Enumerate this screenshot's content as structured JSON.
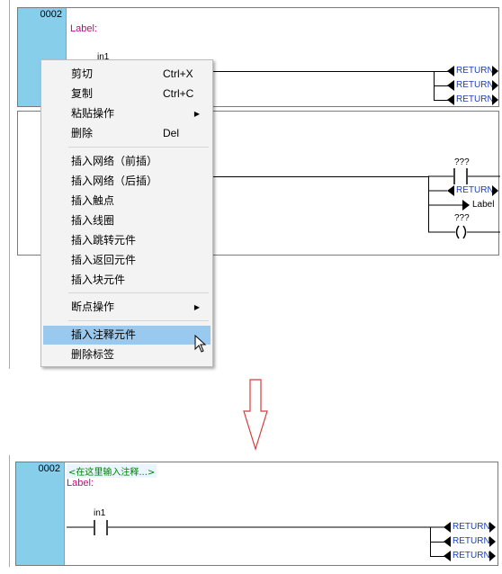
{
  "top_panel": {
    "network_number": "0002",
    "label": "Label:",
    "contact_label": "in1",
    "return_labels": [
      "RETURN",
      "RETURN",
      "RETURN"
    ]
  },
  "second_panel": {
    "contact_label": "???",
    "return_label": "RETURN",
    "jump_label": "Label",
    "coil_label": "???"
  },
  "context_menu": {
    "items": [
      {
        "label": "剪切",
        "shortcut": "Ctrl+X"
      },
      {
        "label": "复制",
        "shortcut": "Ctrl+C"
      },
      {
        "label": "粘贴操作",
        "submenu": "▶"
      },
      {
        "label": "删除",
        "shortcut": "Del"
      },
      {
        "label": "插入网络（前插）"
      },
      {
        "label": "插入网络（后插）"
      },
      {
        "label": "插入触点"
      },
      {
        "label": "插入线圈"
      },
      {
        "label": "插入跳转元件"
      },
      {
        "label": "插入返回元件"
      },
      {
        "label": "插入块元件"
      },
      {
        "label": "断点操作",
        "submenu": "▶"
      },
      {
        "label": "插入注释元件",
        "highlighted": true
      },
      {
        "label": "删除标签"
      }
    ]
  },
  "result_panel": {
    "network_number": "0002",
    "comment": "<在这里输入注释...>",
    "label": "Label:",
    "contact_label": "in1",
    "return_labels": [
      "RETURN",
      "RETURN",
      "RETURN"
    ]
  },
  "colors": {
    "network_number_bg": "#87ceeb",
    "label": "#cc0080",
    "comment": "#008000",
    "return_text": "#1a3fbf",
    "menu_highlight": "#99c9ef",
    "arrow": "#d43c3c"
  }
}
